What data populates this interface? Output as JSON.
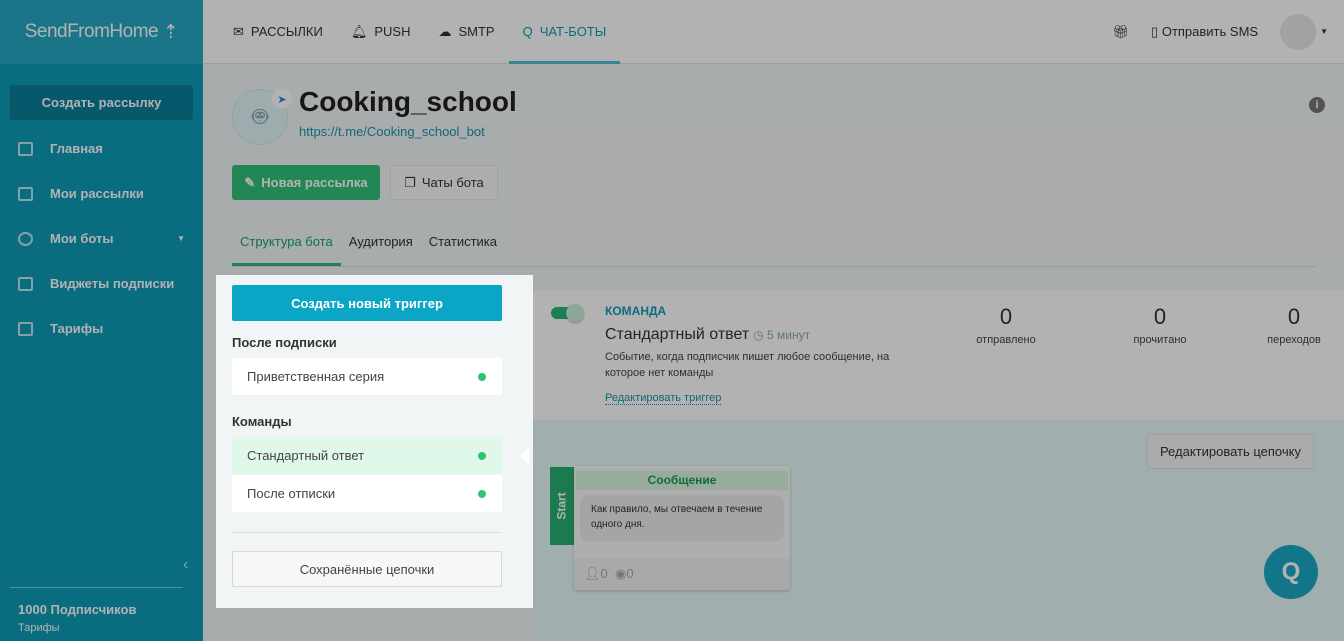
{
  "logo": "SendFromHome",
  "sidebar": {
    "create_label": "Создать рассылку",
    "items": [
      {
        "label": "Главная"
      },
      {
        "label": "Мои рассылки"
      },
      {
        "label": "Мои боты"
      },
      {
        "label": "Виджеты подписки"
      },
      {
        "label": "Тарифы"
      }
    ],
    "subscribers": "1000 Подписчиков",
    "tariffs_link": "Тарифы"
  },
  "topnav": {
    "tabs": [
      {
        "label": "РАССЫЛКИ",
        "icon": "envelope-icon"
      },
      {
        "label": "PUSH",
        "icon": "bell-icon"
      },
      {
        "label": "SMTP",
        "icon": "cloud-upload-icon"
      },
      {
        "label": "ЧАТ-БОТЫ",
        "icon": "chat-icon"
      }
    ],
    "send_sms": "Отправить SMS"
  },
  "bot": {
    "name": "Cooking_school",
    "link": "https://t.me/Cooking_school_bot",
    "new_mailing": "Новая рассылка",
    "bot_chats": "Чаты бота"
  },
  "subtabs": [
    "Структура бота",
    "Аудитория",
    "Статистика"
  ],
  "panel": {
    "create_trigger": "Создать новый триггер",
    "after_subscribe": "После подписки",
    "welcome": "Приветственная серия",
    "commands": "Команды",
    "standard": "Стандартный ответ",
    "after_unsub": "После отписки",
    "saved_chains": "Сохранённые цепочки"
  },
  "trigger": {
    "kind": "КОМАНДА",
    "name": "Стандартный ответ",
    "time": "5 минут",
    "desc": "Событие, когда подписчик пишет любое сообщение, на которое нет команды",
    "edit": "Редактировать триггер",
    "enabled": true,
    "stats": [
      {
        "n": "0",
        "l": "отправлено"
      },
      {
        "n": "0",
        "l": "прочитано"
      },
      {
        "n": "0",
        "l": "переходов"
      }
    ]
  },
  "chain": {
    "edit": "Редактировать цепочку",
    "start": "Start",
    "msg_title": "Сообщение",
    "msg_text": "Как правило, мы отвечаем в течение одного дня.",
    "users": "0",
    "views": "0"
  }
}
